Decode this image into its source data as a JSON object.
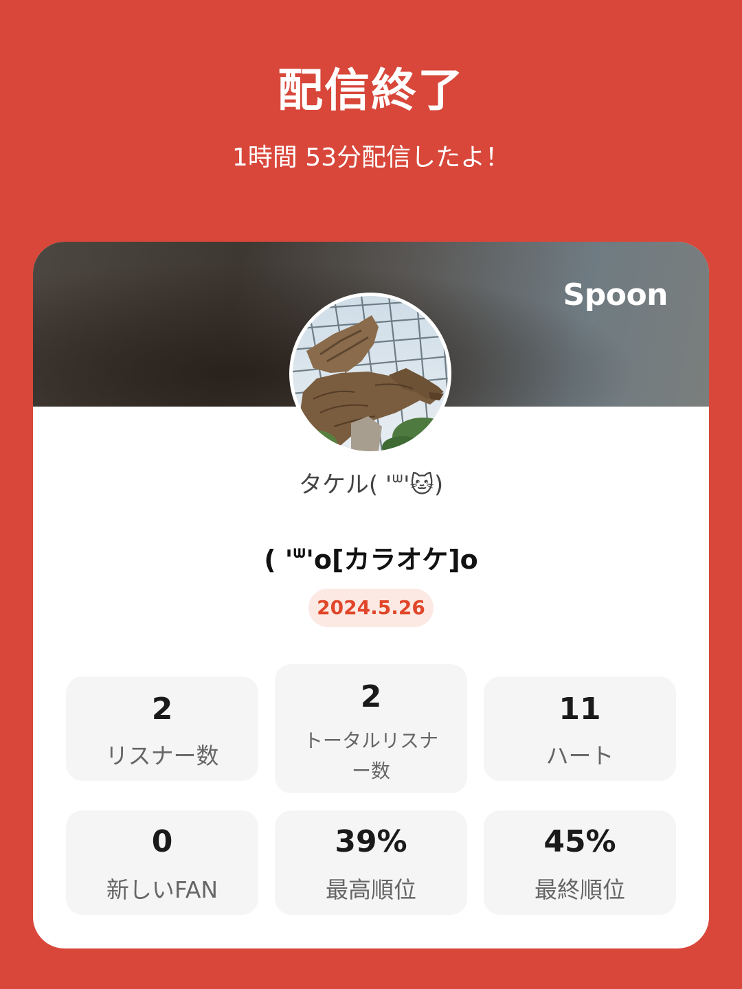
{
  "header": {
    "title": "配信終了",
    "subtitle": "1時間 53分配信したよ！"
  },
  "card": {
    "brand": "Spoon",
    "username": "タケル( 'ᐜ'🐱)",
    "stream_title": "( 'ᐜ'o[カラオケ]o",
    "date": "2024.5.26",
    "avatar_icon": "dragon-avatar-icon"
  },
  "stats": [
    {
      "value": "2",
      "label": "リスナー数"
    },
    {
      "value": "2",
      "label": "トータルリスナー数"
    },
    {
      "value": "11",
      "label": "ハート"
    },
    {
      "value": "0",
      "label": "新しいFAN"
    },
    {
      "value": "39%",
      "label": "最高順位"
    },
    {
      "value": "45%",
      "label": "最終順位"
    }
  ],
  "colors": {
    "background": "#d8473a",
    "badge_text": "#e0472a",
    "badge_bg": "#fde9e3"
  }
}
